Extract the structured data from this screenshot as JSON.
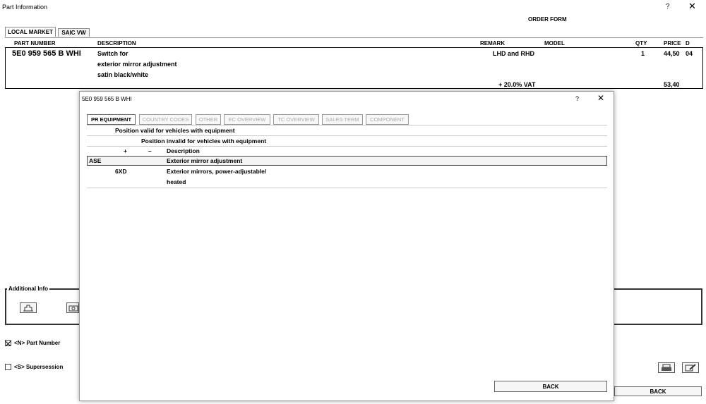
{
  "window": {
    "title": "Part Information",
    "help": "?",
    "close": "✕"
  },
  "order_form": "ORDER FORM",
  "tabs": [
    {
      "label": "LOCAL MARKET"
    },
    {
      "label": "SAIC VW"
    }
  ],
  "columns": {
    "part_number": "PART NUMBER",
    "description": "DESCRIPTION",
    "remark": "REMARK",
    "model": "MODEL",
    "qty": "QTY",
    "price": "PRICE",
    "d": "D"
  },
  "part": {
    "number": "5E0 959 565 B  WHI",
    "desc_lines": [
      "Switch for",
      "exterior mirror adjustment",
      "satin black/white"
    ],
    "remark": "LHD and RHD",
    "qty": "1",
    "price": "44,50",
    "d": "04",
    "vat_label": "+ 20.0% VAT",
    "vat_price": "53,40"
  },
  "additional_info": {
    "label": "Additional Info"
  },
  "options": {
    "part_number": "<N> Part Number",
    "supersession": "<S> Supersession"
  },
  "back_label": "BACK",
  "dialog": {
    "title": "5E0 959 565 B  WHI",
    "help": "?",
    "close": "✕",
    "tabs": [
      "PR EQUIPMENT",
      "COUNTRY CODES",
      "OTHER",
      "EC OVERVIEW",
      "TC OVERVIEW",
      "SALES TERM",
      "COMPONENT"
    ],
    "legend_valid": "Position valid for vehicles with equipment",
    "legend_invalid": "Position invalid for vehicles with equipment",
    "plus": "+",
    "minus": "–",
    "desc_header": "Description",
    "rows": [
      {
        "code": "ASE",
        "desc": "Exterior mirror adjustment"
      },
      {
        "code": "6XD",
        "desc": "Exterior mirrors, power-adjustable/",
        "desc2": "heated"
      }
    ],
    "back_label": "BACK"
  }
}
